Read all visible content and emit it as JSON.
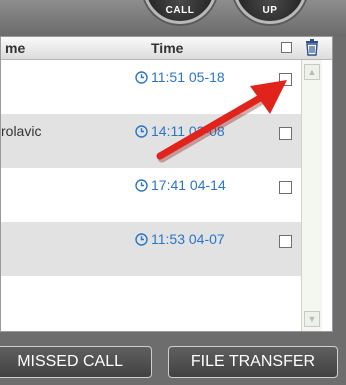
{
  "top_buttons": {
    "call_label": "CALL",
    "up_label": "UP"
  },
  "table": {
    "columns": {
      "name": "me",
      "time": "Time"
    },
    "rows": [
      {
        "name": "",
        "time": "11:51 05-18",
        "alt": false
      },
      {
        "name": "rolavic",
        "time": "14:11 03-08",
        "alt": true
      },
      {
        "name": "",
        "time": "17:41 04-14",
        "alt": false
      },
      {
        "name": "",
        "time": "11:53 04-07",
        "alt": true
      }
    ]
  },
  "bottom_buttons": {
    "missed_call_label": "MISSED CALL",
    "file_transfer_label": "FILE TRANSFER"
  },
  "icons": {
    "clock": "clock-icon",
    "trash": "trash-icon",
    "arrow": "red-arrow-annotation"
  },
  "colors": {
    "time_text": "#2a76c6",
    "alt_row": "#e2e2e2",
    "annotation": "#e0241b"
  }
}
